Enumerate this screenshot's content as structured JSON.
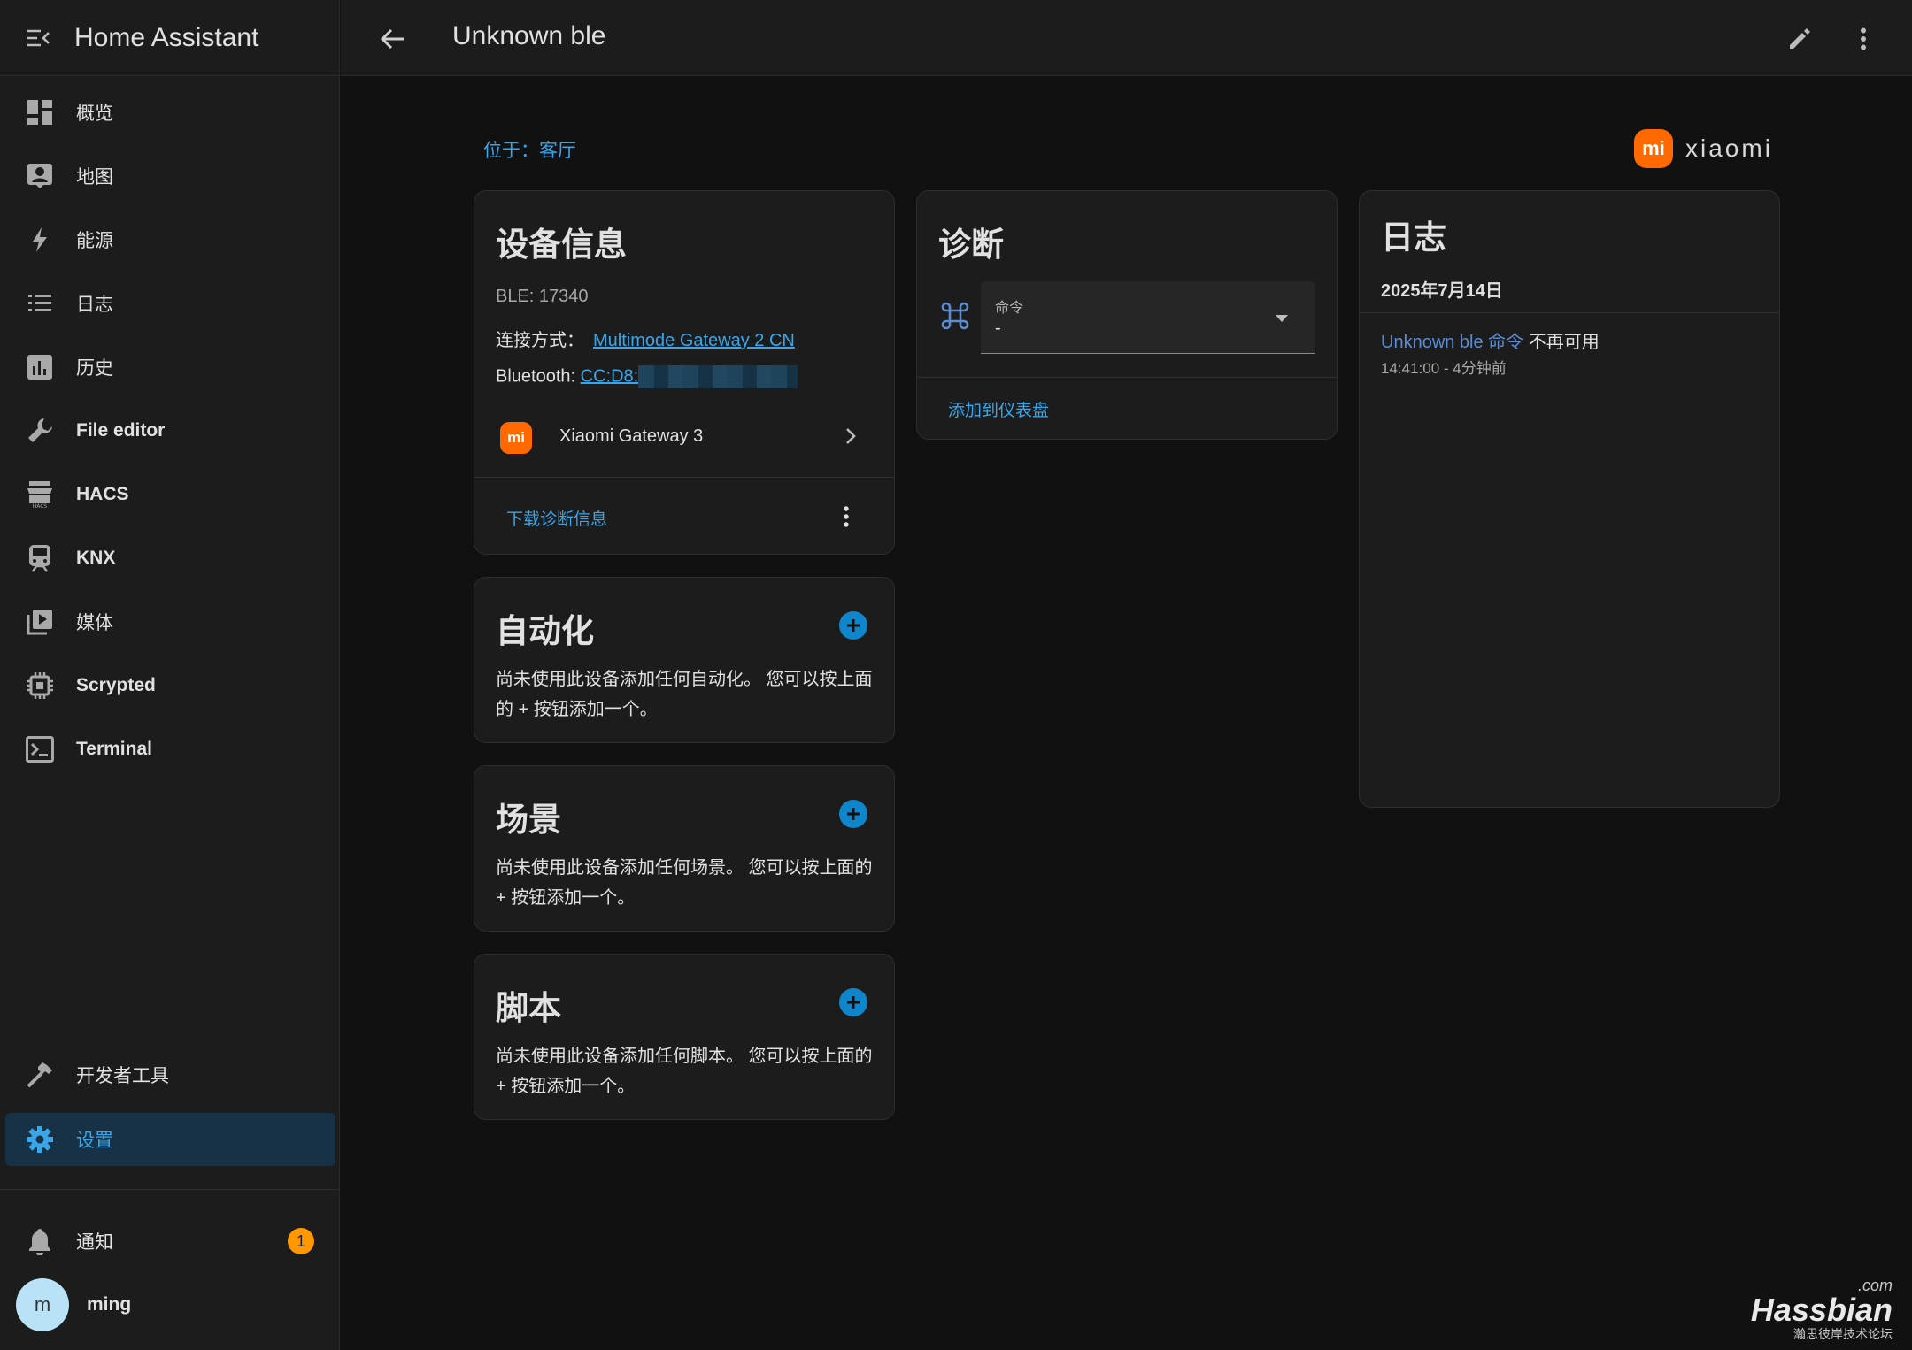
{
  "app": {
    "title": "Home Assistant"
  },
  "sidebar": {
    "items": [
      {
        "label": "概览",
        "icon": "dashboard-icon"
      },
      {
        "label": "地图",
        "icon": "map-icon"
      },
      {
        "label": "能源",
        "icon": "lightning-icon"
      },
      {
        "label": "日志",
        "icon": "logbook-icon"
      },
      {
        "label": "历史",
        "icon": "history-chart-icon"
      },
      {
        "label": "File editor",
        "icon": "wrench-icon"
      },
      {
        "label": "HACS",
        "icon": "hacs-icon"
      },
      {
        "label": "KNX",
        "icon": "train-icon"
      },
      {
        "label": "媒体",
        "icon": "media-icon"
      },
      {
        "label": "Scrypted",
        "icon": "chip-icon"
      },
      {
        "label": "Terminal",
        "icon": "console-icon"
      }
    ],
    "developer_tools": "开发者工具",
    "settings": "设置",
    "notifications": {
      "label": "通知",
      "count": "1"
    },
    "user": {
      "initial": "m",
      "name": "ming"
    }
  },
  "header": {
    "title": "Unknown ble"
  },
  "device": {
    "area_link": "位于：客厅",
    "brand": "xiaomi",
    "brand_logo": "mi",
    "info_card": {
      "title": "设备信息",
      "ble": "BLE: 17340",
      "connection_label": "连接方式：",
      "connection_value": "Multimode Gateway 2 CN",
      "bluetooth_label": "Bluetooth: ",
      "bluetooth_value": "CC:D8:",
      "via_device": "Xiaomi Gateway 3",
      "download_label": "下载诊断信息"
    },
    "diagnostics_card": {
      "title": "诊断",
      "select_label": "命令",
      "select_value": "-",
      "add_to_dashboard": "添加到仪表盘"
    },
    "logbook_card": {
      "title": "日志",
      "date": "2025年7月14日",
      "entry_name": "Unknown ble 命令",
      "entry_state": " 不再可用",
      "entry_time": "14:41:00 - 4分钟前"
    },
    "automation_card": {
      "title": "自动化",
      "body": "尚未使用此设备添加任何自动化。 您可以按上面的 + 按钮添加一个。"
    },
    "scene_card": {
      "title": "场景",
      "body": "尚未使用此设备添加任何场景。 您可以按上面的 + 按钮添加一个。"
    },
    "script_card": {
      "title": "脚本",
      "body": "尚未使用此设备添加任何脚本。 您可以按上面的 + 按钮添加一个。"
    }
  },
  "watermark": {
    "com": ".com",
    "main": "Hassbian",
    "sub": "瀚思彼岸技术论坛"
  },
  "colors": {
    "accent": "#3aa6e8",
    "brand": "#ff6900",
    "badge": "#ff9800"
  }
}
